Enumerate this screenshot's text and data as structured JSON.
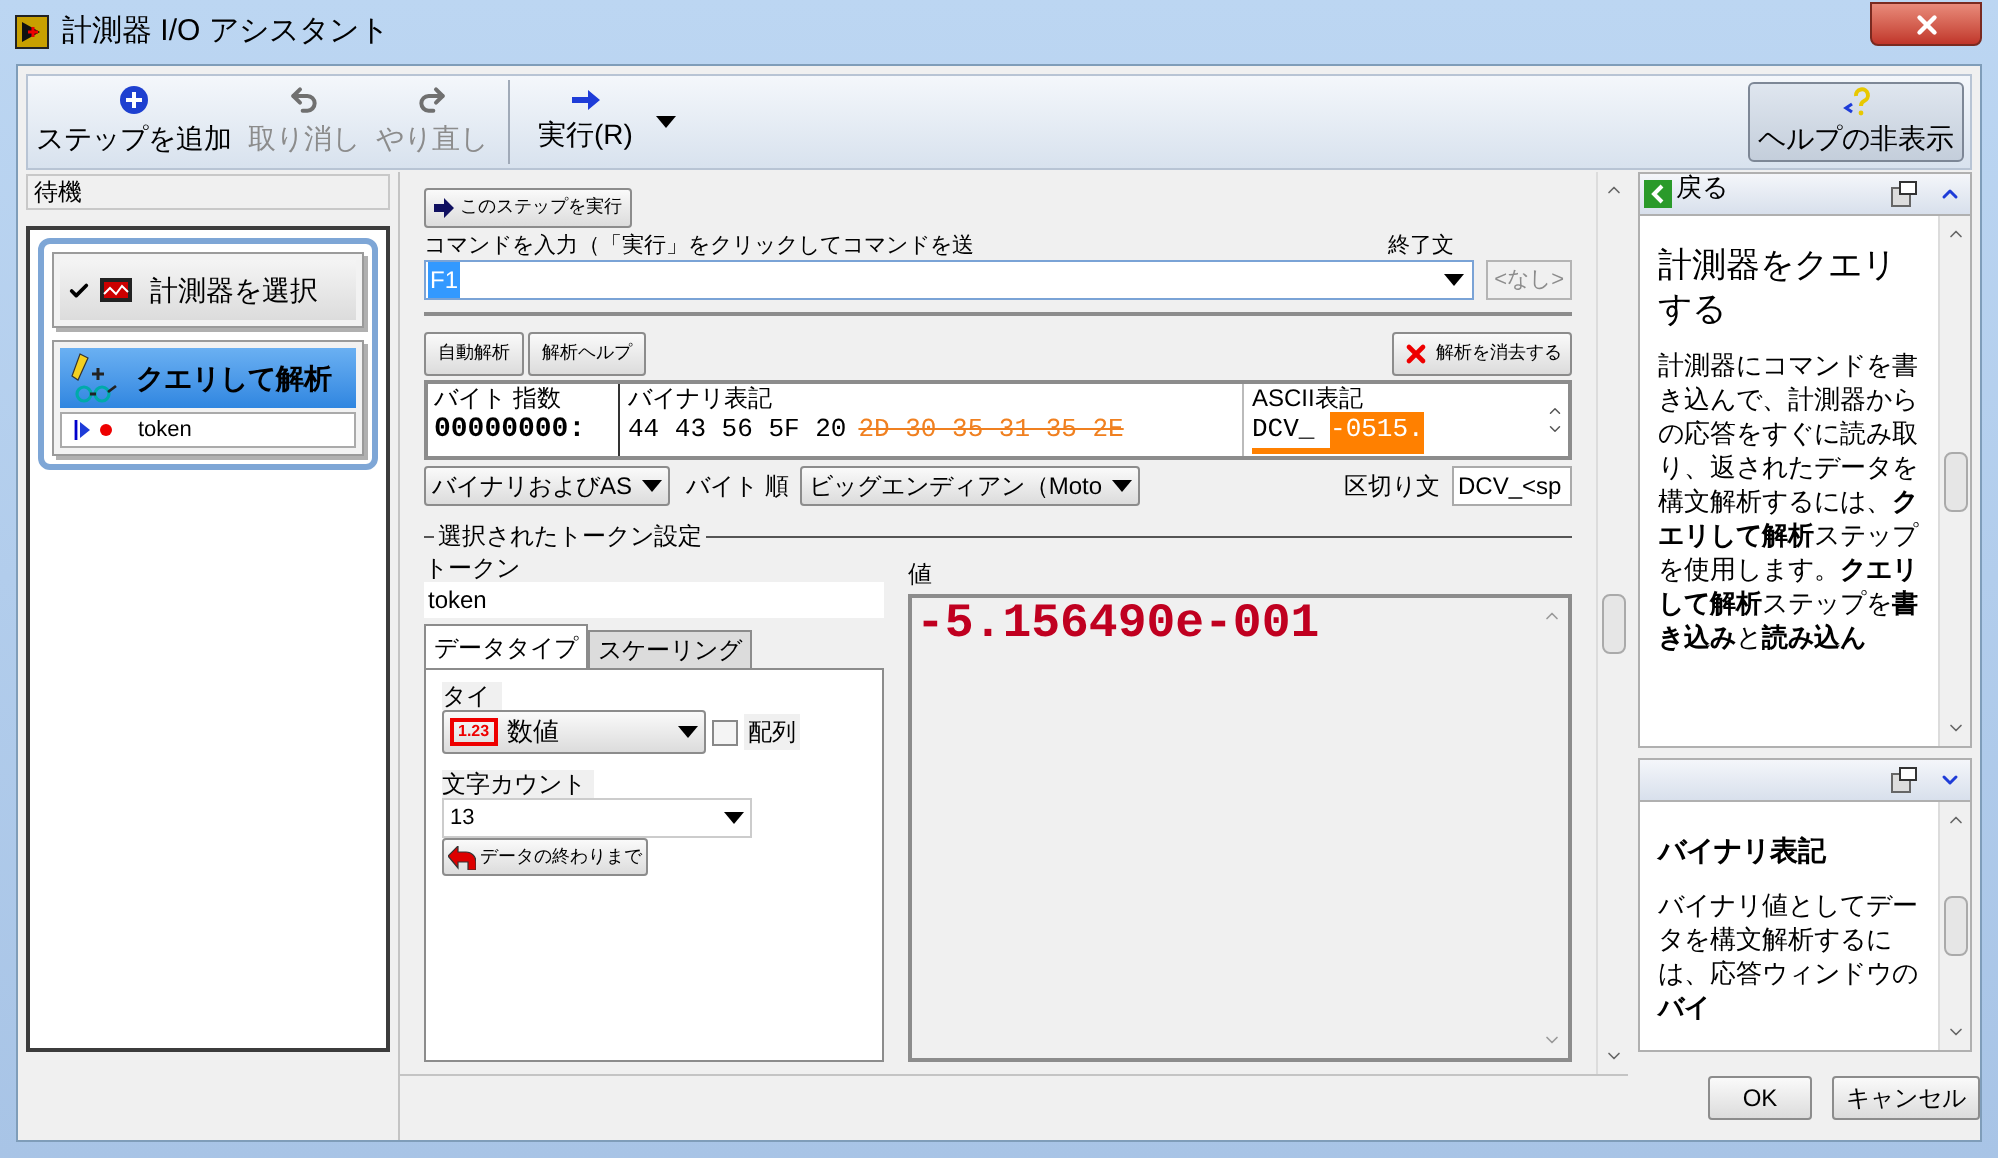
{
  "window": {
    "title": "計測器 I/O アシスタント"
  },
  "toolbar": {
    "buttons": [
      {
        "kind": "add",
        "label": "ステップを追加",
        "disabled": false
      },
      {
        "kind": "undo",
        "label": "取り消し",
        "disabled": true
      },
      {
        "kind": "redo",
        "label": "やり直し",
        "disabled": true
      }
    ],
    "run": {
      "label": "実行(R)"
    },
    "help_toggle": {
      "label": "ヘルプの非表示"
    }
  },
  "status": "待機",
  "steps": [
    {
      "kind": "select",
      "label": "計測器を選択",
      "selected": false,
      "done": true
    },
    {
      "kind": "query",
      "label": "クエリして解析",
      "selected": true,
      "done": false,
      "children": [
        {
          "label": "token"
        }
      ]
    }
  ],
  "command": {
    "run_step": "このステップを実行",
    "label": "コマンドを入力（「実行」をクリックしてコマンドを送",
    "value": "F1",
    "terminator_label": "終了文",
    "terminator": "<なし>",
    "terminator_disabled": true
  },
  "parse": {
    "auto": "自動解析",
    "help": "解析ヘルプ",
    "clear": "解析を消去する"
  },
  "bytes": {
    "headers": [
      "バイト 指数",
      "バイナリ表記",
      "ASCII表記"
    ],
    "offset": "00000000:",
    "binary": [
      {
        "text": "44 43 56 5F 20",
        "parsed": false
      },
      {
        "text": "2D 30 35 31 35 2E",
        "parsed": true
      }
    ],
    "ascii": [
      {
        "text": "DCV_ ",
        "selected": false
      },
      {
        "text": "-0515.",
        "selected": true
      }
    ]
  },
  "options": {
    "display": "バイナリおよびAS",
    "byte_order_label": "バイト 順",
    "byte_order": "ビッグエンディアン（Moto",
    "delimiter_label": "区切り文",
    "delimiter": "DCV_<sp"
  },
  "token_settings": {
    "title": "選択されたトークン設定",
    "token_label": "トークン",
    "token": "token",
    "tabs": [
      {
        "label": "データタイプ",
        "selected": true
      },
      {
        "label": "スケーリング",
        "selected": false
      }
    ],
    "type_label": "タイ",
    "type_icon": "1.23",
    "type": "数値",
    "array_label": "配列",
    "array": false,
    "count_label": "文字カウント",
    "count": "13",
    "to_end": "データの終わりまで",
    "value_label": "値",
    "value": "-5.156490e-001"
  },
  "help": [
    {
      "back": "戻る",
      "title": "計測器をクエリする",
      "body": "計測器にコマンドを書き込んで、計測器からの応答をすぐに読み取り、返されたデータを構文解析するには、**クエリして解析**ステップを使用します。**クエリして解析**ステップを**書き込み**と**読み込ん**",
      "expanded": true
    },
    {
      "title": "バイナリ表記",
      "body": "バイナリ値としてデータを構文解析するには、応答ウィンドウの**バイ**",
      "expanded": false
    }
  ],
  "buttons": [
    {
      "label": "OK"
    },
    {
      "label": "キャンセル"
    }
  ]
}
